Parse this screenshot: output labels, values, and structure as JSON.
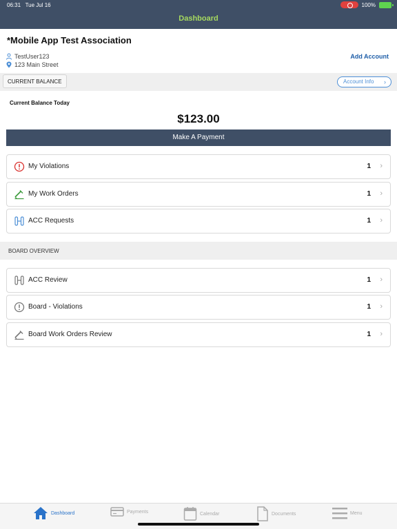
{
  "status_bar": {
    "time": "06:31",
    "date": "Tue Jul 16",
    "battery": "100%"
  },
  "header": {
    "title": "Dashboard"
  },
  "account": {
    "name": "*Mobile App Test Association",
    "user": "TestUser123",
    "address": "123 Main Street",
    "add_account_label": "Add Account"
  },
  "balance": {
    "tab_label": "CURRENT BALANCE",
    "account_info_label": "Account Info",
    "today_label": "Current Balance Today",
    "amount": "$123.00",
    "pay_label": "Make A Payment"
  },
  "my_items": [
    {
      "label": "My Violations",
      "count": "1",
      "icon": "alert-circle-icon"
    },
    {
      "label": "My Work Orders",
      "count": "1",
      "icon": "wrench-icon"
    },
    {
      "label": "ACC Requests",
      "count": "1",
      "icon": "blueprint-icon"
    }
  ],
  "board": {
    "section_title": "BOARD OVERVIEW",
    "items": [
      {
        "label": "ACC Review",
        "count": "1",
        "icon": "blueprint-icon"
      },
      {
        "label": "Board - Violations",
        "count": "1",
        "icon": "alert-circle-icon"
      },
      {
        "label": "Board Work Orders Review",
        "count": "1",
        "icon": "wrench-icon"
      }
    ]
  },
  "tabbar": [
    {
      "label": "Dashboard",
      "icon": "home-icon",
      "active": true
    },
    {
      "label": "Payments",
      "icon": "card-icon",
      "active": false
    },
    {
      "label": "Calendar",
      "icon": "calendar-icon",
      "active": false
    },
    {
      "label": "Documents",
      "icon": "document-icon",
      "active": false
    },
    {
      "label": "Menu",
      "icon": "menu-icon",
      "active": false
    }
  ],
  "colors": {
    "header_bg": "#3f4f66",
    "header_title": "#a6d95f",
    "link_blue": "#1e5ea8",
    "violation_red": "#d9312e",
    "work_order_green": "#3a9a3a",
    "acc_blue": "#4d8fd6",
    "active_tab": "#2a73c9"
  }
}
